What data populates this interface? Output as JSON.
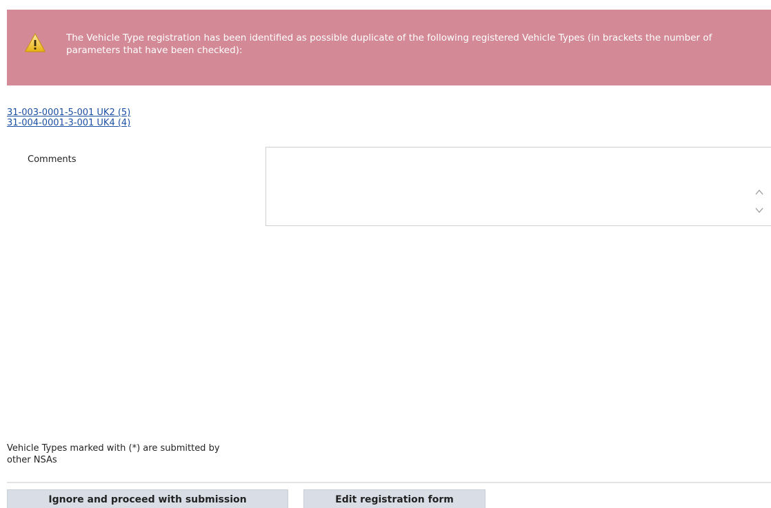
{
  "alert": {
    "icon": "warning-icon",
    "background_color": "#d48a96",
    "message": "The Vehicle Type registration has been identified as possible duplicate of the following registered Vehicle Types (in brackets the number of parameters that have been checked):"
  },
  "duplicates": [
    {
      "label": "31-003-0001-5-001 UK2 (5)"
    },
    {
      "label": "31-004-0001-3-001 UK4 (4)"
    }
  ],
  "comments": {
    "label": "Comments",
    "value": ""
  },
  "note": "Vehicle Types marked with (*) are submitted by other NSAs",
  "buttons": {
    "ignore_label": "Ignore and proceed with submission",
    "edit_label": "Edit registration form"
  }
}
